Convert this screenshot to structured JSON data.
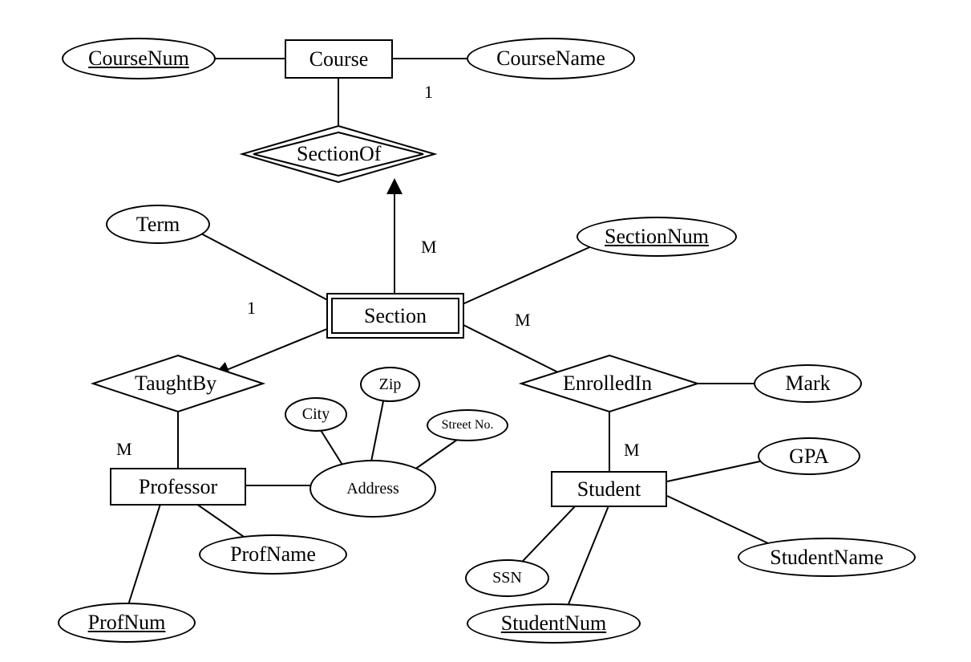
{
  "entities": {
    "course": "Course",
    "section": "Section",
    "professor": "Professor",
    "student": "Student"
  },
  "relationships": {
    "sectionOf": "SectionOf",
    "taughtBy": "TaughtBy",
    "enrolledIn": "EnrolledIn"
  },
  "attributes": {
    "courseNum": "CourseNum",
    "courseName": "CourseName",
    "term": "Term",
    "sectionNum": "SectionNum",
    "zip": "Zip",
    "city": "City",
    "streetNo": "Street No.",
    "address": "Address",
    "profName": "ProfName",
    "profNum": "ProfNum",
    "mark": "Mark",
    "gpa": "GPA",
    "ssn": "SSN",
    "studentName": "StudentName",
    "studentNum": "StudentNum"
  },
  "cardinalities": {
    "courseOne": "1",
    "sectionM1": "M",
    "taughtByOne": "1",
    "taughtByM": "M",
    "enrolledInSectionM": "M",
    "enrolledInStudentM": "M"
  }
}
